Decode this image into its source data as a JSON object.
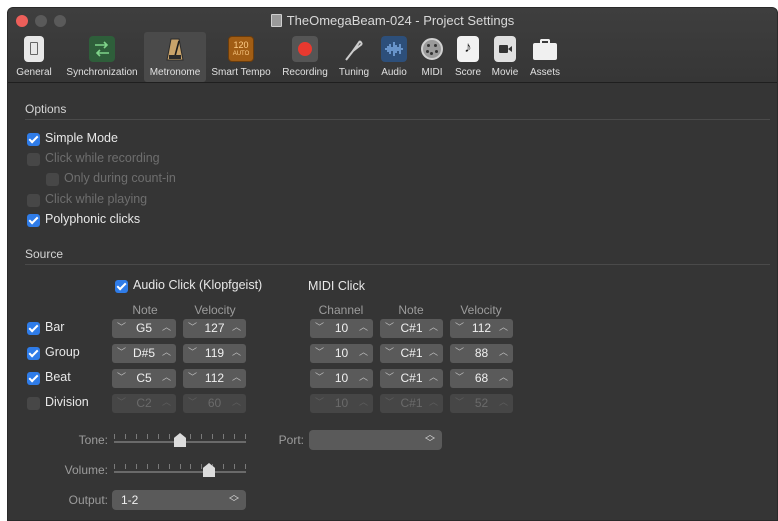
{
  "window": {
    "title": "TheOmegaBeam-024 - Project Settings"
  },
  "toolbar": {
    "items": [
      {
        "label": "General",
        "icon": "general-icon",
        "color": "#e8e8e8"
      },
      {
        "label": "Synchronization",
        "icon": "sync-icon",
        "color": "#2e5e3a"
      },
      {
        "label": "Metronome",
        "icon": "metronome-icon",
        "color": "#c9a36a"
      },
      {
        "label": "Smart Tempo",
        "icon": "smart-tempo-icon",
        "color": "#a15d14",
        "badge": "120",
        "badge_sub": "AUTO"
      },
      {
        "label": "Recording",
        "icon": "record-icon",
        "color": "#e8392f"
      },
      {
        "label": "Tuning",
        "icon": "tuning-fork-icon",
        "color": "#cccccc"
      },
      {
        "label": "Audio",
        "icon": "waveform-icon",
        "color": "#2d4f7a"
      },
      {
        "label": "MIDI",
        "icon": "midi-icon",
        "color": "#9a9a9a"
      },
      {
        "label": "Score",
        "icon": "note-icon",
        "color": "#f2f2f2"
      },
      {
        "label": "Movie",
        "icon": "camera-icon",
        "color": "#e0e0e0"
      },
      {
        "label": "Assets",
        "icon": "briefcase-icon",
        "color": "#f0f0f0"
      }
    ],
    "selected": "Metronome"
  },
  "options": {
    "heading": "Options",
    "simple_mode": {
      "label": "Simple Mode",
      "checked": true,
      "enabled": true
    },
    "click_while_recording": {
      "label": "Click while recording",
      "checked": false,
      "enabled": false
    },
    "only_during_count_in": {
      "label": "Only during count-in",
      "checked": false,
      "enabled": false
    },
    "click_while_playing": {
      "label": "Click while playing",
      "checked": false,
      "enabled": false
    },
    "polyphonic_clicks": {
      "label": "Polyphonic clicks",
      "checked": true,
      "enabled": true
    }
  },
  "source": {
    "heading": "Source",
    "audio_click": {
      "label": "Audio Click (Klopfgeist)",
      "checked": true
    },
    "midi_click_label": "MIDI Click",
    "audio_headers": {
      "note": "Note",
      "velocity": "Velocity"
    },
    "midi_headers": {
      "channel": "Channel",
      "note": "Note",
      "velocity": "Velocity"
    },
    "rows": [
      {
        "label": "Bar",
        "checked": true,
        "enabled": true,
        "note": "G5",
        "velocity": "127",
        "channel": "10",
        "midi_note": "C#1",
        "midi_velocity": "112"
      },
      {
        "label": "Group",
        "checked": true,
        "enabled": true,
        "note": "D#5",
        "velocity": "119",
        "channel": "10",
        "midi_note": "C#1",
        "midi_velocity": "88"
      },
      {
        "label": "Beat",
        "checked": true,
        "enabled": true,
        "note": "C5",
        "velocity": "112",
        "channel": "10",
        "midi_note": "C#1",
        "midi_velocity": "68"
      },
      {
        "label": "Division",
        "checked": false,
        "enabled": false,
        "note": "C2",
        "velocity": "60",
        "channel": "10",
        "midi_note": "C#1",
        "midi_velocity": "52"
      }
    ],
    "tone": {
      "label": "Tone:",
      "level": 0.5
    },
    "volume": {
      "label": "Volume:",
      "level": 0.72
    },
    "output": {
      "label": "Output:",
      "value": "1-2"
    },
    "port": {
      "label": "Port:",
      "value": ""
    }
  },
  "colors": {
    "accent": "#2f7ce8",
    "window_bg": "#353535",
    "close": "#ed5f5a"
  }
}
